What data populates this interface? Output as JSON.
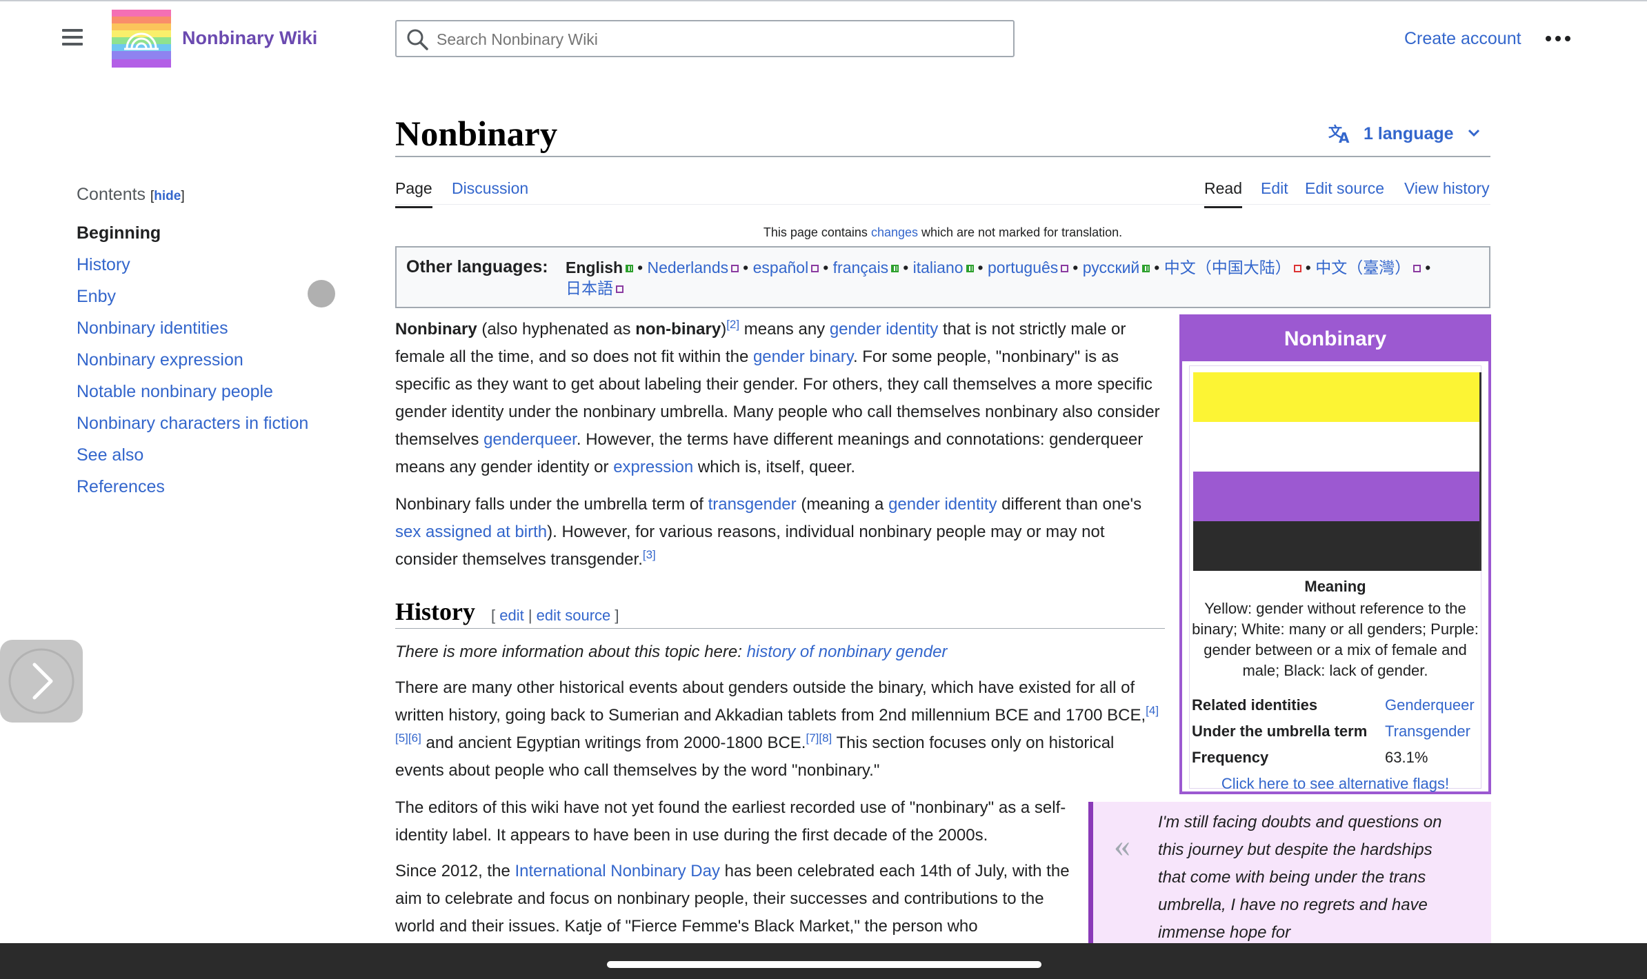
{
  "header": {
    "site_name": "Nonbinary Wiki",
    "search_placeholder": "Search Nonbinary Wiki",
    "create_account": "Create account"
  },
  "toc": {
    "title": "Contents",
    "hide_open": "[",
    "hide_label": "hide",
    "hide_close": "]",
    "items": [
      {
        "label": "Beginning",
        "active": true
      },
      {
        "label": "History"
      },
      {
        "label": "Enby"
      },
      {
        "label": "Nonbinary identities"
      },
      {
        "label": "Nonbinary expression"
      },
      {
        "label": "Notable nonbinary people"
      },
      {
        "label": "Nonbinary characters in fiction"
      },
      {
        "label": "See also"
      },
      {
        "label": "References"
      }
    ]
  },
  "page": {
    "title": "Nonbinary",
    "language_button": "1 language",
    "tabs_left": [
      "Page",
      "Discussion"
    ],
    "tabs_right": [
      "Read",
      "Edit",
      "Edit source",
      "View history"
    ],
    "translate_notice": {
      "before": "This page contains ",
      "link": "changes",
      "after": " which are not marked for translation."
    }
  },
  "other_languages": {
    "label": "Other languages:",
    "items": [
      "English",
      "Nederlands",
      "español",
      "français",
      "italiano",
      "português",
      "русский",
      "中文（中国大陆）",
      "中文（臺灣）",
      "日本語"
    ]
  },
  "intro": {
    "p1": {
      "b1": "Nonbinary",
      "t1": " (also hyphenated as ",
      "b2": "non-binary",
      "t2": ")",
      "ref2": "[2]",
      "t3": " means any ",
      "l1": "gender identity",
      "t4": " that is not strictly male or female all the time, and so does not fit within the ",
      "l2": "gender binary",
      "t5": ". For some people, \"nonbinary\" is as specific as they want to get about labeling their gender. For others, they call themselves a more specific gender identity under the nonbinary umbrella. Many people who call themselves nonbinary also consider themselves ",
      "l3": "genderqueer",
      "t6": ". However, the terms have different meanings and connotations: genderqueer means any gender identity or ",
      "l4": "expression",
      "t7": " which is, itself, queer."
    },
    "p2": {
      "t1": "Nonbinary falls under the umbrella term of ",
      "l1": "transgender",
      "t2": " (meaning a ",
      "l2": "gender identity",
      "t3": " different than one's ",
      "l3": "sex assigned at birth",
      "t4": "). However, for various reasons, individual nonbinary people may or may not consider themselves transgender.",
      "ref3": "[3]"
    }
  },
  "history": {
    "heading": "History",
    "edit_open": "[ ",
    "edit": "edit",
    "sep": " | ",
    "edit_source": "edit source",
    "edit_close": " ]",
    "hatnote_text": "There is more information about this topic here: ",
    "hatnote_link": "history of nonbinary gender",
    "p1_a": "There are many other historical events about genders outside the binary, which have existed for all of written history, going back to Sumerian and Akkadian tablets from 2nd millennium BCE and 1700 BCE,",
    "p1_refs1": "[4][5][6]",
    "p1_b": " and ancient Egyptian writings from 2000-1800 BCE.",
    "p1_refs2": "[7][8]",
    "p1_c": " This section focuses only on historical events about people who call themselves by the word \"nonbinary.\"",
    "p2": "The editors of this wiki have not yet found the earliest recorded use of \"nonbinary\" as a self-identity label. It appears to have been in use during the first decade of the 2000s.",
    "p3_a": "Since 2012, the ",
    "p3_link": "International Nonbinary Day",
    "p3_b": " has been celebrated each 14th of July, with the aim to celebrate and focus on nonbinary people, their successes and contributions to the world and their issues. Katje of \"Fierce Femme's Black Market,\" the person who"
  },
  "infobox": {
    "title": "Nonbinary",
    "flag_colors": [
      "#fcf434",
      "#ffffff",
      "#9c59d1",
      "#2c2c2c"
    ],
    "meaning_heading": "Meaning",
    "meaning_text": "Yellow: gender without reference to the binary; White: many or all genders; Purple: gender between or a mix of female and male; Black: lack of gender.",
    "rows": [
      {
        "key": "Related identities",
        "value": "Genderqueer"
      },
      {
        "key": "Under the umbrella term",
        "value": "Transgender"
      },
      {
        "key": "Frequency",
        "value": "63.1%"
      }
    ],
    "alt_flags": "Click here to see alternative flags!"
  },
  "quote": {
    "mark": "«",
    "text": "I'm still facing doubts and questions on this journey but despite the hardships that come with being under the trans umbrella, I have no regrets and have immense hope for"
  }
}
